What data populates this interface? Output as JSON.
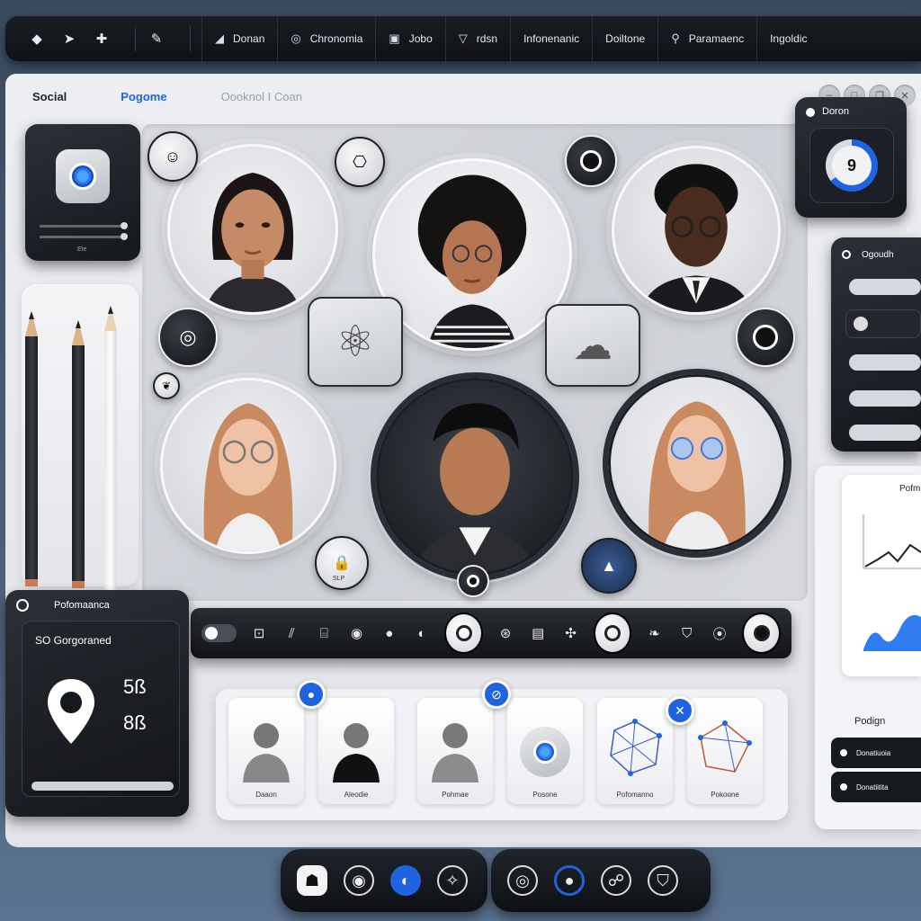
{
  "topbar": {
    "icons": [
      "diamond-icon",
      "arrow-icon",
      "plus-icon",
      "brush-icon"
    ],
    "nav": [
      {
        "icon": "text-icon",
        "label": "Donan"
      },
      {
        "icon": "circle-icon",
        "label": "Chronomia"
      },
      {
        "icon": "grid-icon",
        "label": "Jobo"
      },
      {
        "icon": "triangle-icon",
        "label": "rdsn"
      },
      {
        "icon": "",
        "label": "Infonenanic"
      },
      {
        "icon": "",
        "label": "Doiltone"
      },
      {
        "icon": "pin-icon",
        "label": "Paramaenc"
      },
      {
        "icon": "",
        "label": "Ingoldic"
      }
    ]
  },
  "header": {
    "title": "Social",
    "active": "Pogome",
    "crumbs": "Oooknol I Coan"
  },
  "dial_card": {
    "title": "Doron",
    "value": "9"
  },
  "growth_card": {
    "title": "Ogoudh"
  },
  "perf_card": {
    "title": "Pofomaanca",
    "subtitle": "SO Gorgoraned",
    "values": [
      "5ß",
      "8ß"
    ]
  },
  "right_panel": {
    "chart_title": "Pofm",
    "section": "Podign",
    "items": [
      "Donatiuoia",
      "Donatiitita"
    ]
  },
  "profiles": {
    "cards": [
      {
        "label": "Daaon"
      },
      {
        "label": "Aleodie"
      },
      {
        "label": "Pohmae"
      },
      {
        "label": "Posone"
      },
      {
        "label": "Pofomanno"
      },
      {
        "label": "Pokoone"
      }
    ]
  },
  "knob_label": "SLP",
  "small_card_label": "Ete",
  "colors": {
    "accent": "#1f63e0",
    "dark": "#15181d",
    "surface": "#eceef2"
  }
}
